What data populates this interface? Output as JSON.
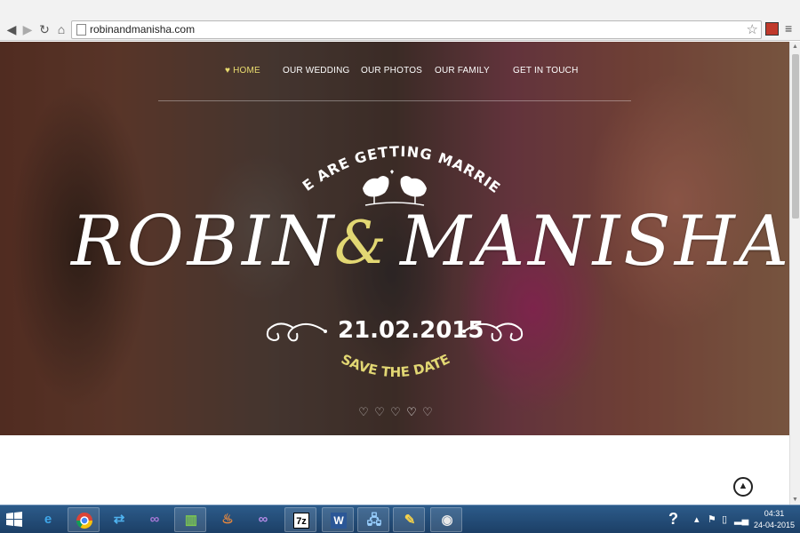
{
  "browser": {
    "url": "robinandmanisha.com",
    "icons": [
      "back-icon",
      "forward-icon",
      "reload-icon",
      "home-icon",
      "bookmark-star-icon",
      "extension-icon",
      "menu-icon"
    ]
  },
  "nav": {
    "items": [
      {
        "label": "HOME",
        "active": true
      },
      {
        "label": "OUR WEDDING",
        "active": false
      },
      {
        "label": "OUR PHOTOS",
        "active": false
      },
      {
        "label": "OUR FAMILY",
        "active": false
      },
      {
        "label": "GET IN TOUCH",
        "active": false
      }
    ]
  },
  "hero": {
    "headline": "WE ARE GETTING MARRIED",
    "name_left": "ROBIN",
    "ampersand": "&",
    "name_right": "MANISHA",
    "date": "21.02.2015",
    "save_the_date": "SAVE THE DATE",
    "slides": 5,
    "active_slide": 4
  },
  "colors": {
    "accent": "#e2d773",
    "nav_active": "#e9dc6f",
    "text": "#ffffff"
  },
  "taskbar": {
    "apps": [
      "internet-explorer-icon",
      "chrome-icon",
      "teamviewer-icon",
      "visual-studio-icon",
      "excel-chart-icon",
      "fire-app-icon",
      "visual-studio-2-icon",
      "7zip-icon",
      "word-icon",
      "network-icon",
      "paint-icon",
      "media-icon"
    ],
    "seven_zip_label": "7z",
    "word_label": "W",
    "time": "04:31",
    "date": "24-04-2015"
  }
}
